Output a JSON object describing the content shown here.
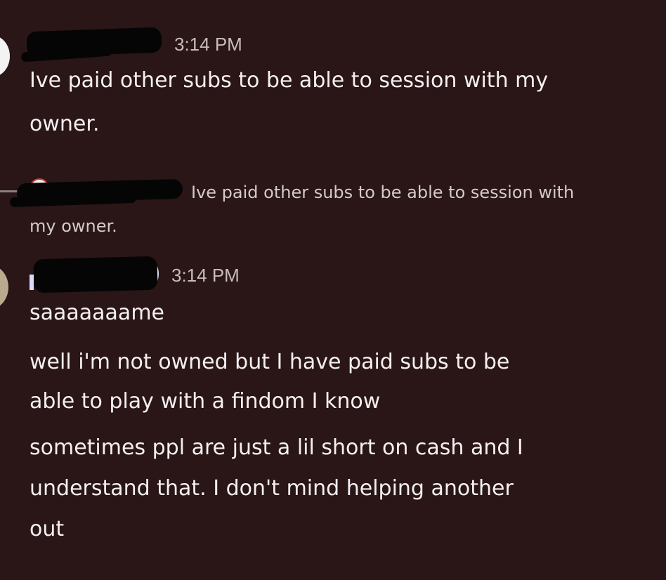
{
  "theme": {
    "background": "#2a1517",
    "text": "#f4f0f0",
    "muted": "#c8bcbd"
  },
  "messages": [
    {
      "timestamp": "3:14 PM",
      "lines": [
        "Ive paid other subs to be able to session with my",
        "owner."
      ]
    },
    {
      "reply_preview": {
        "line1": "Ive paid other subs to be able to session with",
        "line2": "my owner."
      }
    },
    {
      "timestamp": "3:14 PM",
      "lines": [
        "saaaaaaame",
        "well i'm not owned but I have paid subs to be",
        "able to play with a findom I know",
        "sometimes ppl are just a lil short on cash and I",
        "understand that. I don't mind helping another",
        "out"
      ]
    }
  ]
}
